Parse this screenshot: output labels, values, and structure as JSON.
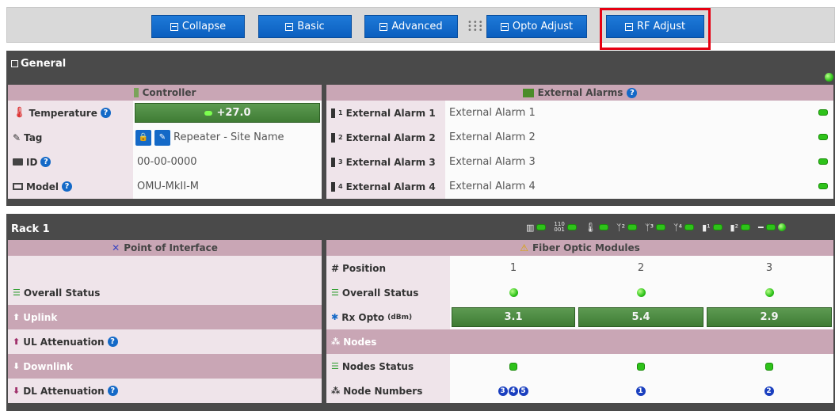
{
  "toolbar": {
    "collapse": "Collapse",
    "basic": "Basic",
    "advanced": "Advanced",
    "opto_adjust": "Opto Adjust",
    "rf_adjust": "RF Adjust"
  },
  "general": {
    "title": "General",
    "controller": {
      "header": "Controller",
      "temperature_label": "Temperature",
      "temperature_value": "+27.0",
      "tag_label": "Tag",
      "tag_value": "Repeater - Site Name",
      "id_label": "ID",
      "id_value": "00-00-0000",
      "model_label": "Model",
      "model_value": "OMU-MkII-M"
    },
    "external_alarms": {
      "header": "External Alarms",
      "items": [
        {
          "label": "External Alarm 1",
          "sup": "1",
          "value": "External Alarm 1"
        },
        {
          "label": "External Alarm 2",
          "sup": "2",
          "value": "External Alarm 2"
        },
        {
          "label": "External Alarm 3",
          "sup": "3",
          "value": "External Alarm 3"
        },
        {
          "label": "External Alarm 4",
          "sup": "4",
          "value": "External Alarm 4"
        }
      ]
    }
  },
  "rack": {
    "title": "Rack 1",
    "poi": {
      "header": "Point of Interface",
      "overall_status": "Overall Status",
      "uplink": "Uplink",
      "ul_attenuation": "UL Attenuation",
      "downlink": "Downlink",
      "dl_attenuation": "DL Attenuation"
    },
    "fom": {
      "header": "Fiber Optic Modules",
      "position_label": "Position",
      "positions": [
        "1",
        "2",
        "3"
      ],
      "overall_status": "Overall Status",
      "rx_opto_label": "Rx Opto",
      "rx_opto_unit": "(dBm)",
      "rx_opto_values": [
        "3.1",
        "5.4",
        "2.9"
      ],
      "nodes_label": "Nodes",
      "nodes_status": "Nodes Status",
      "node_numbers_label": "Node Numbers",
      "node_numbers": [
        [
          "3",
          "4",
          "5"
        ],
        [
          "1"
        ],
        [
          "2"
        ]
      ]
    }
  },
  "colors": {
    "button_blue": "#0b5fbf",
    "highlight_red": "#e60012",
    "status_green": "#2ec21a",
    "header_mauve": "#c9a6b5"
  }
}
